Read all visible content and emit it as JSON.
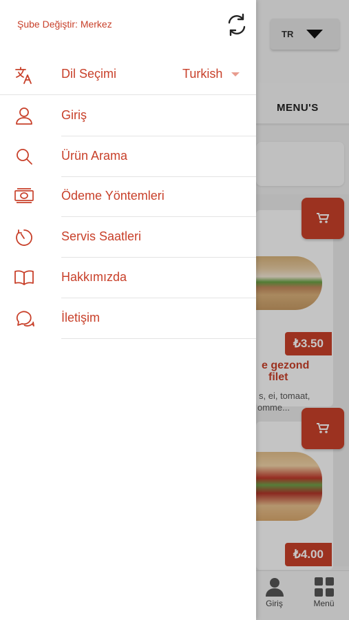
{
  "background": {
    "language_button": "TR",
    "tab_label": "MENU'S",
    "products": [
      {
        "price": "₺3.50",
        "title_line1": "e gezond",
        "title_line2": "filet",
        "desc_line1": "s, ei, tomaat,",
        "desc_line2": "omme..."
      },
      {
        "price": "₺4.00"
      }
    ],
    "bottom_nav": [
      {
        "label": "Giriş",
        "icon": "person-icon"
      },
      {
        "label": "Menü",
        "icon": "grid-icon"
      }
    ]
  },
  "drawer": {
    "branch_label": "Şube Değiştir: Merkez",
    "refresh_icon": "refresh-icon",
    "language": {
      "label": "Dil Seçimi",
      "value": "Turkish",
      "icon": "translate-icon"
    },
    "items": [
      {
        "label": "Giriş",
        "icon": "user-icon"
      },
      {
        "label": "Ürün Arama",
        "icon": "search-icon"
      },
      {
        "label": "Ödeme Yöntemleri",
        "icon": "money-icon"
      },
      {
        "label": "Servis Saatleri",
        "icon": "timer-icon"
      },
      {
        "label": "Hakkımızda",
        "icon": "book-icon"
      },
      {
        "label": "İletişim",
        "icon": "chat-icon"
      }
    ]
  },
  "colors": {
    "accent": "#c8402a",
    "divider": "#e3e3e3"
  }
}
